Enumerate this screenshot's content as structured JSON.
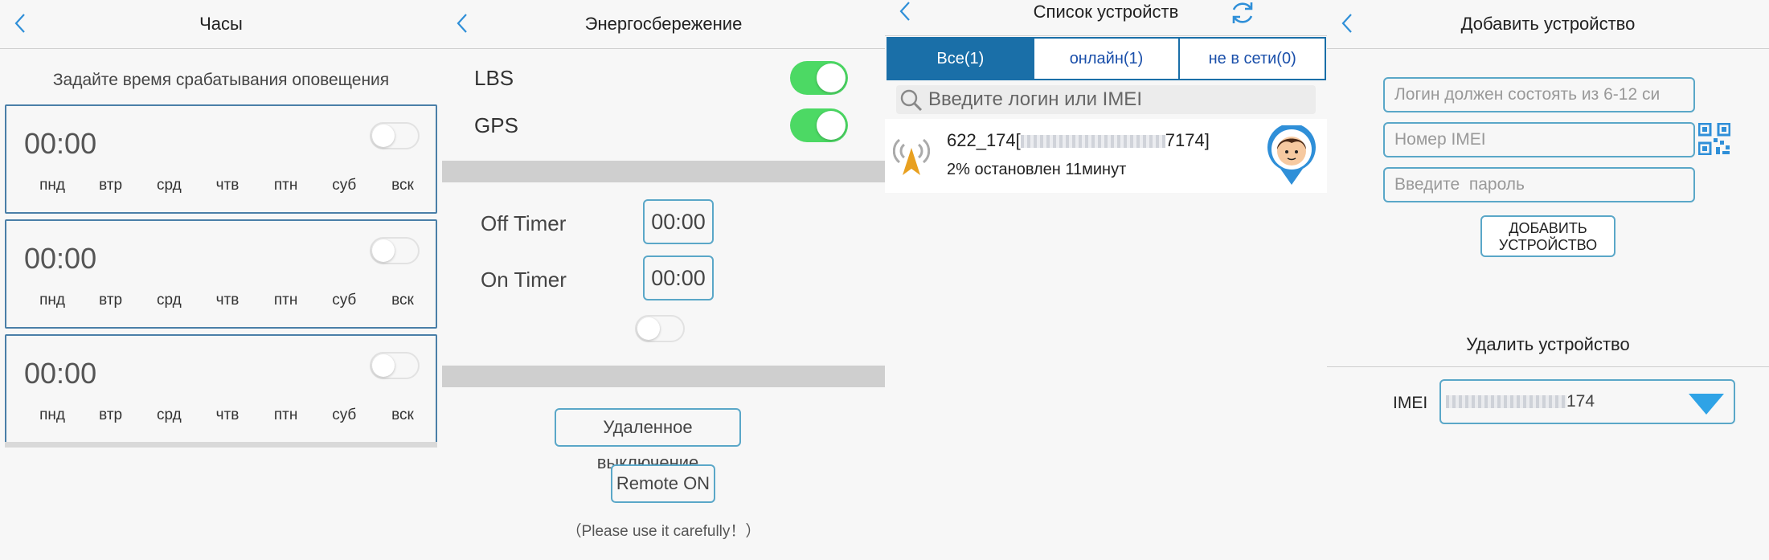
{
  "clock": {
    "title": "Часы",
    "subtitle": "Задайте время срабатывания оповещения",
    "alarms": [
      {
        "time": "00:00",
        "enabled": false
      },
      {
        "time": "00:00",
        "enabled": false
      },
      {
        "time": "00:00",
        "enabled": false
      }
    ],
    "days": [
      "пнд",
      "втр",
      "срд",
      "чтв",
      "птн",
      "суб",
      "вск"
    ]
  },
  "power": {
    "title": "Энергосбережение",
    "lbs_label": "LBS",
    "lbs_on": true,
    "gps_label": "GPS",
    "gps_on": true,
    "off_timer_label": "Off Timer",
    "off_timer_value": "00:00",
    "on_timer_label": "On Timer",
    "on_timer_value": "00:00",
    "timer_enabled": false,
    "remote_off_label": "Удаленное выключение",
    "remote_on_label": "Remote ON",
    "note": "（Please use it carefully！）"
  },
  "devices": {
    "title": "Список устройств",
    "tabs": [
      "Все(1)",
      "онлайн(1)",
      "не в сети(0)"
    ],
    "active_tab": 0,
    "search_placeholder": "Введите логин или IMEI",
    "items": [
      {
        "name_prefix": "622_174[",
        "name_suffix": "7174]",
        "status": "2%  остановлен 11минут"
      }
    ]
  },
  "add": {
    "title": "Добавить устройство",
    "login_placeholder": "Логин должен состоять из 6-12 си",
    "imei_placeholder": "Номер IMEI",
    "password_placeholder": "Введите  пароль",
    "add_button_line1": "ДОБАВИТЬ",
    "add_button_line2": "УСТРОЙСТВО",
    "delete_title": "Удалить устройство",
    "imei_label": "IMEI",
    "imei_value_suffix": "174"
  },
  "colors": {
    "accent_blue": "#1a6fa8",
    "toggle_on": "#4cd964",
    "outline_blue": "#5aa7c8",
    "caret_blue": "#2fa3e6"
  }
}
